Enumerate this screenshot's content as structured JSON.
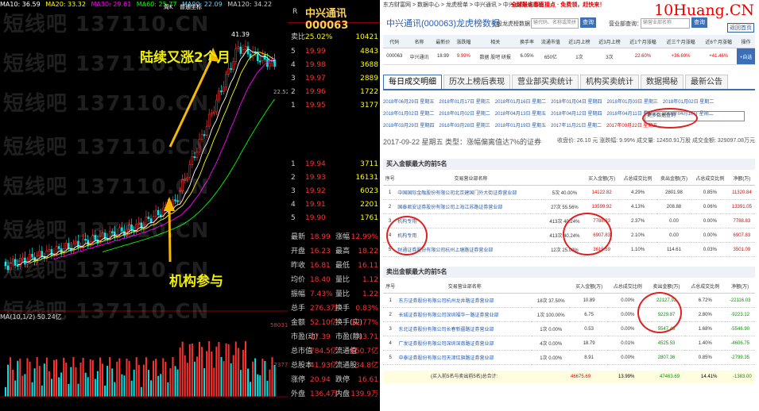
{
  "chart_data": {
    "type": "candlestick",
    "ma_header": [
      "MA10: 36.59",
      "MA20: 33.32",
      "MA30: 29.61",
      "MA60: 25.77",
      "MA90: 22.09",
      "MA120: 34.22"
    ],
    "period_label": "周K",
    "period_label2": "普通坐标",
    "high_label": "41.39",
    "right_price_label": "22.52",
    "volume_ma_label": "MA(10,1/2) 50.24亿",
    "volume_scale_1": "58031",
    "volume_scale_2": "17377",
    "colors": {
      "up": "#ff3232",
      "down": "#00ffff",
      "ma1": "#ffffff",
      "ma2": "#ffff00",
      "ma3": "#ff00ff",
      "ma4": "#00ff00"
    }
  },
  "watermark": [
    "短线吧 137110.CN",
    "短线吧 137110.CN",
    "短线吧 137110.CN",
    "短线吧 137110.CN",
    "短线吧 137110.CN",
    "短线吧 137110.CN",
    "短线吧 137110.CN",
    "短线吧 137110.CN"
  ],
  "annotations": {
    "rise": "陆续又涨2个月",
    "inst": "机构参与"
  },
  "quote": {
    "title": "中兴通讯 000063",
    "r_label": "R",
    "change_pct": "25.02%",
    "change_pct_label": "卖比",
    "top_right": "10421",
    "asks": [
      {
        "n": "5",
        "p": "19.99",
        "v": "4843"
      },
      {
        "n": "4",
        "p": "19.98",
        "v": "3688"
      },
      {
        "n": "3",
        "p": "19.97",
        "v": "2889"
      },
      {
        "n": "2",
        "p": "19.96",
        "v": "1722"
      },
      {
        "n": "1",
        "p": "19.95",
        "v": "3177"
      }
    ],
    "sell_label": "卖",
    "bids": [
      {
        "n": "1",
        "p": "19.94",
        "v": "3711"
      },
      {
        "n": "2",
        "p": "19.93",
        "v": "16131"
      },
      {
        "n": "3",
        "p": "19.92",
        "v": "6023"
      },
      {
        "n": "4",
        "p": "19.91",
        "v": "2201"
      },
      {
        "n": "5",
        "p": "19.90",
        "v": "1761"
      }
    ],
    "buy_label": "买",
    "stats": [
      {
        "a": "最新",
        "b": "18.99",
        "c": "涨幅",
        "d": "12.99%"
      },
      {
        "a": "开盘",
        "b": "16.23",
        "c": "最高",
        "d": "18.22"
      },
      {
        "a": "昨收",
        "b": "16.81",
        "c": "最低",
        "d": "16.11"
      },
      {
        "a": "均价",
        "b": "18.40",
        "c": "量比",
        "d": "1.12"
      },
      {
        "a": "振幅",
        "b": "7.43%",
        "c": "量比",
        "d": "1.22"
      },
      {
        "a": "总手",
        "b": "276.3万",
        "c": "换手",
        "d": "0.83%"
      },
      {
        "a": "金额",
        "b": "52.10亿",
        "c": "换手(实)",
        "d": "12.77%"
      },
      {
        "a": "市盈(动)",
        "b": "17.39",
        "c": "市盈(静)",
        "d": "13.71"
      },
      {
        "a": "总市值",
        "b": "784.5亿",
        "c": "流通值",
        "d": "650.7亿"
      },
      {
        "a": "总股本",
        "b": "41.93亿",
        "c": "流通股",
        "d": "34.8亿"
      },
      {
        "a": "涨停",
        "b": "20.94",
        "c": "跌停",
        "d": "16.61"
      },
      {
        "a": "外盘",
        "b": "136.4万",
        "c": "内盘",
        "d": "139.9万"
      }
    ]
  },
  "page": {
    "breadcrumb": "东方财富网 > 数据中心 > 龙虎榜单 > 中兴通讯 > 中兴通讯-龙虎榜",
    "promo": "全球最省事直接点 · 免费领，赶快来！",
    "site": "10Huang.CN",
    "title": "中兴通讯(000063)龙虎榜数据",
    "search_label": "个股龙虎榜数据：",
    "search_placeholder": "输代码、名称或简拼",
    "search_btn": "查询",
    "dept_label": "营业部查询：",
    "dept_placeholder": "输营业部名称",
    "dept_btn": "查询",
    "home_btn": "返回首页",
    "sum_headers": [
      "代码",
      "名称",
      "最新价",
      "涨跌幅",
      "相关",
      "换手率",
      "流通市值",
      "近1月上榜",
      "近3月上榜",
      "近1个月涨幅",
      "近三个月涨幅",
      "近6个月涨幅",
      "操作"
    ],
    "sum_row": [
      "000063",
      "中兴通讯",
      "18.99",
      "9.99%",
      "数据 股吧 研报",
      "6.05%",
      "650亿",
      "1次",
      "3次",
      "22.60%",
      "+36.69%",
      "+41.46%",
      "+自选"
    ],
    "tabs": [
      "每日成交明细",
      "历次上榜后表现",
      "营业部买卖统计",
      "机构买卖统计",
      "数据揭秘",
      "最新公告"
    ],
    "dates": [
      "2018年06月29日 星期五",
      "2018年01月17日 星期三",
      "2018年01月16日 星期二",
      "2018年01月04日 星期四",
      "2018年01月03日 星期三",
      "2018年01月02日 星期二",
      "2018年01月02日 星期二",
      "2018年01月02日 星期二",
      "2018年04月13日 星期五",
      "2018年04月12日 星期四",
      "2018年04月11日 星期三",
      "2018年04月10日 星期二",
      "2018年03月29日 星期四",
      "2018年03月28日 星期三",
      "2018年01月19日 星期五",
      "2017年11月21日 星期二",
      "2017年09月22日 星期五"
    ],
    "more_dates": "更多数据查询",
    "info_date": "2017-09-22 星期五   类型：涨幅偏离值达7%的证券",
    "info_right": "收盘价: 26.10 元  涨跌幅: 9.99%  成交量: 12450.91万股  成交金额: 329097.08万元",
    "buy_title": "买入金额最大的前5名",
    "sell_title": "卖出金额最大的前5名",
    "col_headers": [
      "序号",
      "交易营业部名称",
      "",
      "买入金额(万)",
      "占总成交比例",
      "卖出金额(万)",
      "占总成交比例",
      "净额(万)"
    ],
    "buy_rows": [
      [
        "1",
        "中国国际金融股份有限公司北京建国门外大街证券营业部",
        "5次 40.00%",
        "14122.82",
        "4.29%",
        "2801.98",
        "0.85%",
        "11320.84"
      ],
      [
        "2",
        "国泰君安证券股份有限公司上海江苏路证券营业部",
        "27次 55.56%",
        "13599.92",
        "4.13%",
        "208.88",
        "0.06%",
        "13391.05"
      ],
      [
        "3",
        "机构专用",
        "413次 40.24%",
        "7788.83",
        "2.37%",
        "0.00",
        "0.00%",
        "7788.83"
      ],
      [
        "4",
        "机构专用",
        "413次 40.24%",
        "6907.83",
        "2.10%",
        "0.00",
        "0.00%",
        "6907.83"
      ],
      [
        "5",
        "财通证券股份有限公司杭州上塘路证券营业部",
        "12次 25.00%",
        "3615.59",
        "1.10%",
        "114.61",
        "0.03%",
        "3501.09"
      ]
    ],
    "sell_rows": [
      [
        "1",
        "东方证券股份有限公司杭州龙井路证券营业部",
        "18次 37.50%",
        "10.89",
        "0.00%",
        "22127.92",
        "6.72%",
        "-22116.03"
      ],
      [
        "2",
        "长城证券股份有限公司深圳福华一路证券营业部",
        "1次 100.00%",
        "6.75",
        "0.00%",
        "9229.87",
        "2.80%",
        "-9223.12"
      ],
      [
        "3",
        "东北证券股份有限公司长春新疆路证券营业部",
        "1次 0.00%",
        "0.53",
        "0.00%",
        "5547.43",
        "1.68%",
        "-5546.90"
      ],
      [
        "4",
        "广发证券股份有限公司深圳深南路证券营业部",
        "4次 0.00%",
        "18.79",
        "0.01%",
        "4525.53",
        "1.40%",
        "-4606.75"
      ],
      [
        "5",
        "中泰证券股份有限公司天津红旗路证券营业部",
        "1次 0.00%",
        "8.91",
        "0.00%",
        "2807.36",
        "0.85%",
        "-2799.35"
      ]
    ],
    "total_label": "(买入前5名与卖出前5名)总合计:",
    "total_values": [
      "46675.69",
      "13.99%",
      "47463.69",
      "14.41%",
      "-1383.00"
    ]
  }
}
